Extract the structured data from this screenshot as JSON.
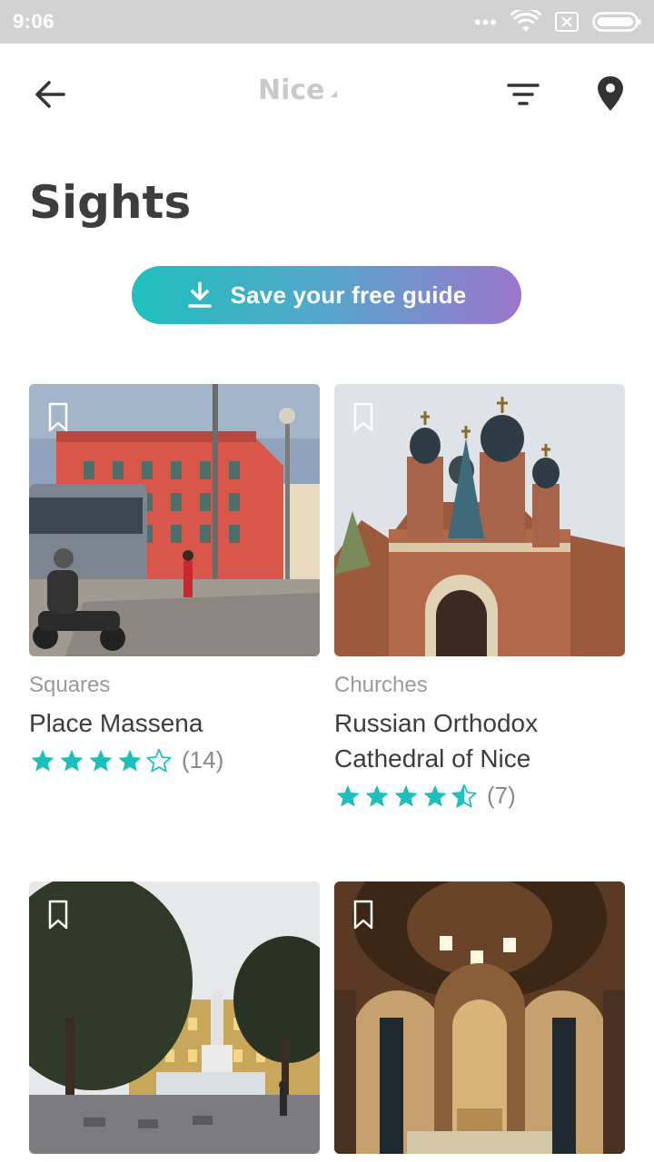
{
  "status": {
    "time": "9:06",
    "dots": "•••",
    "icons": [
      "wifi-icon",
      "sim-error-icon",
      "battery-icon"
    ]
  },
  "header": {
    "city": "Nice",
    "icons": [
      "back-arrow-icon",
      "filter-icon",
      "map-pin-icon"
    ]
  },
  "page": {
    "title": "Sights"
  },
  "save_guide": {
    "label": "Save your free guide",
    "icon": "download-icon"
  },
  "colors": {
    "star": "#1fbfbd",
    "gradient_start": "#1fbfbd",
    "gradient_end": "#9c76cd"
  },
  "cards": [
    {
      "category": "Squares",
      "title": "Place Massena",
      "rating": 4,
      "reviews": "(14)"
    },
    {
      "category": "Churches",
      "title": "Russian Orthodox Cathedral of Nice",
      "rating": 4.5,
      "reviews": "(7)"
    },
    {
      "category": "",
      "title": "",
      "rating": null,
      "reviews": ""
    },
    {
      "category": "",
      "title": "",
      "rating": null,
      "reviews": ""
    }
  ]
}
